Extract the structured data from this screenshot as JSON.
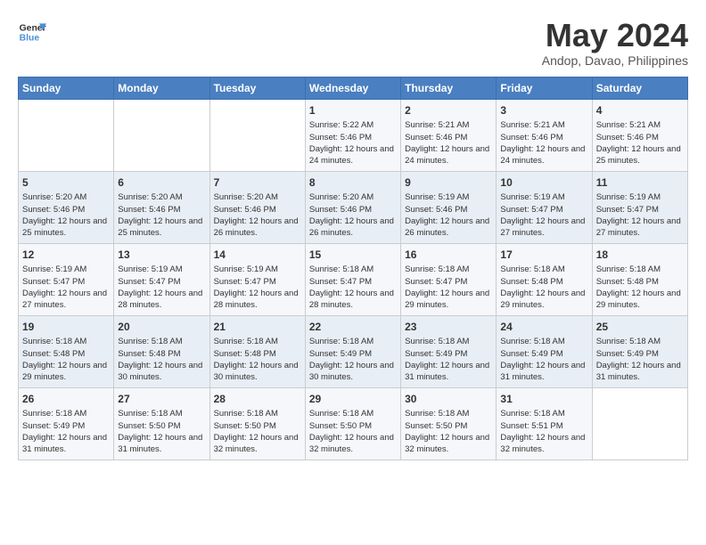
{
  "header": {
    "logo_line1": "General",
    "logo_line2": "Blue",
    "month_year": "May 2024",
    "location": "Andop, Davao, Philippines"
  },
  "weekdays": [
    "Sunday",
    "Monday",
    "Tuesday",
    "Wednesday",
    "Thursday",
    "Friday",
    "Saturday"
  ],
  "weeks": [
    [
      {
        "day": "",
        "sunrise": "",
        "sunset": "",
        "daylight": ""
      },
      {
        "day": "",
        "sunrise": "",
        "sunset": "",
        "daylight": ""
      },
      {
        "day": "",
        "sunrise": "",
        "sunset": "",
        "daylight": ""
      },
      {
        "day": "1",
        "sunrise": "Sunrise: 5:22 AM",
        "sunset": "Sunset: 5:46 PM",
        "daylight": "Daylight: 12 hours and 24 minutes."
      },
      {
        "day": "2",
        "sunrise": "Sunrise: 5:21 AM",
        "sunset": "Sunset: 5:46 PM",
        "daylight": "Daylight: 12 hours and 24 minutes."
      },
      {
        "day": "3",
        "sunrise": "Sunrise: 5:21 AM",
        "sunset": "Sunset: 5:46 PM",
        "daylight": "Daylight: 12 hours and 24 minutes."
      },
      {
        "day": "4",
        "sunrise": "Sunrise: 5:21 AM",
        "sunset": "Sunset: 5:46 PM",
        "daylight": "Daylight: 12 hours and 25 minutes."
      }
    ],
    [
      {
        "day": "5",
        "sunrise": "Sunrise: 5:20 AM",
        "sunset": "Sunset: 5:46 PM",
        "daylight": "Daylight: 12 hours and 25 minutes."
      },
      {
        "day": "6",
        "sunrise": "Sunrise: 5:20 AM",
        "sunset": "Sunset: 5:46 PM",
        "daylight": "Daylight: 12 hours and 25 minutes."
      },
      {
        "day": "7",
        "sunrise": "Sunrise: 5:20 AM",
        "sunset": "Sunset: 5:46 PM",
        "daylight": "Daylight: 12 hours and 26 minutes."
      },
      {
        "day": "8",
        "sunrise": "Sunrise: 5:20 AM",
        "sunset": "Sunset: 5:46 PM",
        "daylight": "Daylight: 12 hours and 26 minutes."
      },
      {
        "day": "9",
        "sunrise": "Sunrise: 5:19 AM",
        "sunset": "Sunset: 5:46 PM",
        "daylight": "Daylight: 12 hours and 26 minutes."
      },
      {
        "day": "10",
        "sunrise": "Sunrise: 5:19 AM",
        "sunset": "Sunset: 5:47 PM",
        "daylight": "Daylight: 12 hours and 27 minutes."
      },
      {
        "day": "11",
        "sunrise": "Sunrise: 5:19 AM",
        "sunset": "Sunset: 5:47 PM",
        "daylight": "Daylight: 12 hours and 27 minutes."
      }
    ],
    [
      {
        "day": "12",
        "sunrise": "Sunrise: 5:19 AM",
        "sunset": "Sunset: 5:47 PM",
        "daylight": "Daylight: 12 hours and 27 minutes."
      },
      {
        "day": "13",
        "sunrise": "Sunrise: 5:19 AM",
        "sunset": "Sunset: 5:47 PM",
        "daylight": "Daylight: 12 hours and 28 minutes."
      },
      {
        "day": "14",
        "sunrise": "Sunrise: 5:19 AM",
        "sunset": "Sunset: 5:47 PM",
        "daylight": "Daylight: 12 hours and 28 minutes."
      },
      {
        "day": "15",
        "sunrise": "Sunrise: 5:18 AM",
        "sunset": "Sunset: 5:47 PM",
        "daylight": "Daylight: 12 hours and 28 minutes."
      },
      {
        "day": "16",
        "sunrise": "Sunrise: 5:18 AM",
        "sunset": "Sunset: 5:47 PM",
        "daylight": "Daylight: 12 hours and 29 minutes."
      },
      {
        "day": "17",
        "sunrise": "Sunrise: 5:18 AM",
        "sunset": "Sunset: 5:48 PM",
        "daylight": "Daylight: 12 hours and 29 minutes."
      },
      {
        "day": "18",
        "sunrise": "Sunrise: 5:18 AM",
        "sunset": "Sunset: 5:48 PM",
        "daylight": "Daylight: 12 hours and 29 minutes."
      }
    ],
    [
      {
        "day": "19",
        "sunrise": "Sunrise: 5:18 AM",
        "sunset": "Sunset: 5:48 PM",
        "daylight": "Daylight: 12 hours and 29 minutes."
      },
      {
        "day": "20",
        "sunrise": "Sunrise: 5:18 AM",
        "sunset": "Sunset: 5:48 PM",
        "daylight": "Daylight: 12 hours and 30 minutes."
      },
      {
        "day": "21",
        "sunrise": "Sunrise: 5:18 AM",
        "sunset": "Sunset: 5:48 PM",
        "daylight": "Daylight: 12 hours and 30 minutes."
      },
      {
        "day": "22",
        "sunrise": "Sunrise: 5:18 AM",
        "sunset": "Sunset: 5:49 PM",
        "daylight": "Daylight: 12 hours and 30 minutes."
      },
      {
        "day": "23",
        "sunrise": "Sunrise: 5:18 AM",
        "sunset": "Sunset: 5:49 PM",
        "daylight": "Daylight: 12 hours and 31 minutes."
      },
      {
        "day": "24",
        "sunrise": "Sunrise: 5:18 AM",
        "sunset": "Sunset: 5:49 PM",
        "daylight": "Daylight: 12 hours and 31 minutes."
      },
      {
        "day": "25",
        "sunrise": "Sunrise: 5:18 AM",
        "sunset": "Sunset: 5:49 PM",
        "daylight": "Daylight: 12 hours and 31 minutes."
      }
    ],
    [
      {
        "day": "26",
        "sunrise": "Sunrise: 5:18 AM",
        "sunset": "Sunset: 5:49 PM",
        "daylight": "Daylight: 12 hours and 31 minutes."
      },
      {
        "day": "27",
        "sunrise": "Sunrise: 5:18 AM",
        "sunset": "Sunset: 5:50 PM",
        "daylight": "Daylight: 12 hours and 31 minutes."
      },
      {
        "day": "28",
        "sunrise": "Sunrise: 5:18 AM",
        "sunset": "Sunset: 5:50 PM",
        "daylight": "Daylight: 12 hours and 32 minutes."
      },
      {
        "day": "29",
        "sunrise": "Sunrise: 5:18 AM",
        "sunset": "Sunset: 5:50 PM",
        "daylight": "Daylight: 12 hours and 32 minutes."
      },
      {
        "day": "30",
        "sunrise": "Sunrise: 5:18 AM",
        "sunset": "Sunset: 5:50 PM",
        "daylight": "Daylight: 12 hours and 32 minutes."
      },
      {
        "day": "31",
        "sunrise": "Sunrise: 5:18 AM",
        "sunset": "Sunset: 5:51 PM",
        "daylight": "Daylight: 12 hours and 32 minutes."
      },
      {
        "day": "",
        "sunrise": "",
        "sunset": "",
        "daylight": ""
      }
    ]
  ]
}
